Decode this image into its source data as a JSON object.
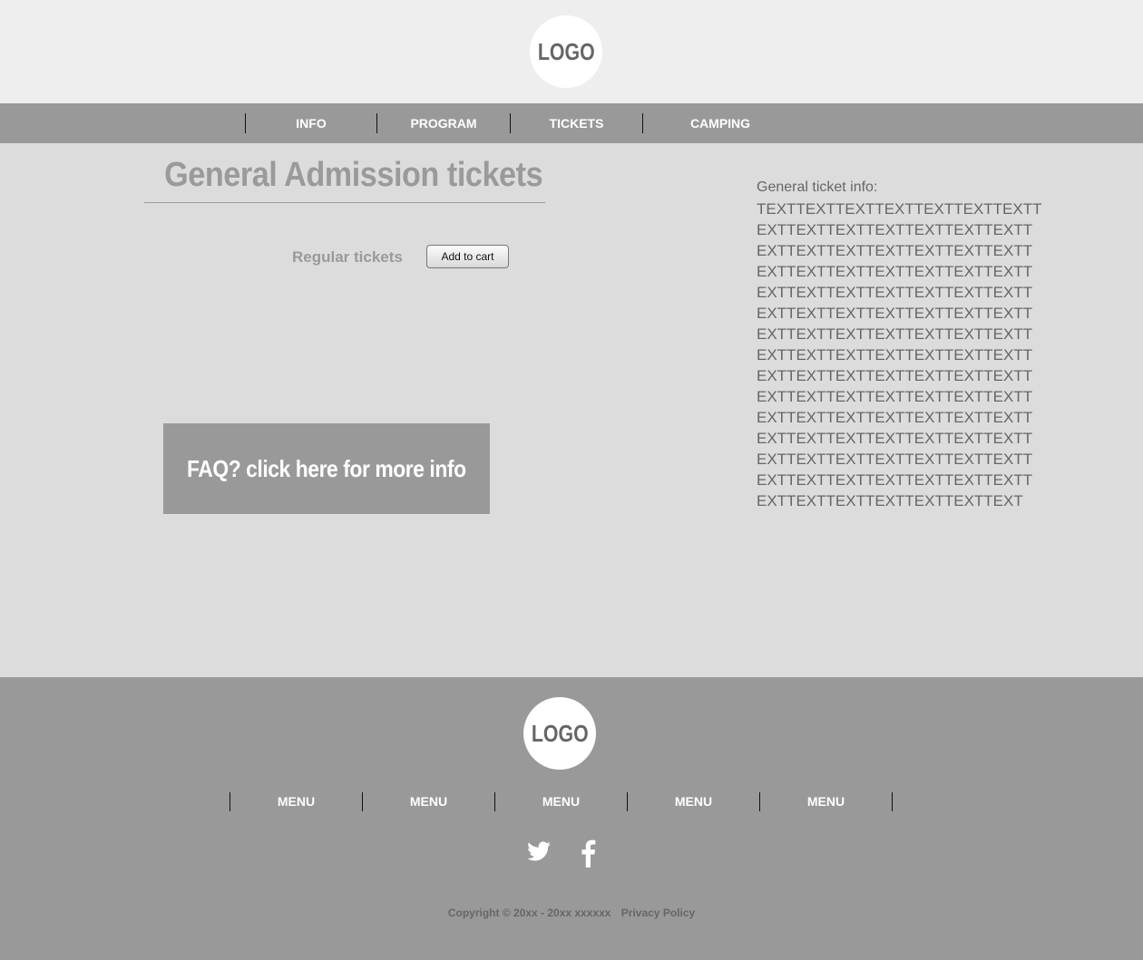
{
  "header": {
    "logo_text": "LOGO"
  },
  "nav": {
    "items": [
      {
        "label": "INFO"
      },
      {
        "label": "PROGRAM"
      },
      {
        "label": "TICKETS"
      },
      {
        "label": "CAMPING"
      }
    ]
  },
  "main": {
    "title": "General Admission tickets",
    "ticket_label": "Regular tickets",
    "add_to_cart_label": "Add to cart",
    "faq_label": "FAQ? click here for more info",
    "info_heading": "General ticket info:",
    "info_body": "TEXTTEXTTEXTTEXTTEXTTEXTTEXTTEXTTEXTTEXTTEXTTEXTTEXTTEXTTEXTTEXTTEXTTEXTTEXTTEXTTEXTTEXTTEXTTEXTTEXTTEXTTEXTTEXTTEXTTEXTTEXTTEXTTEXTTEXTTEXTTEXTTEXTTEXTTEXTTEXTTEXTTEXTTEXTTEXTTEXTTEXTTEXTTEXTTEXTTEXTTEXTTEXTTEXTTEXTTEXTTEXTTEXTTEXTTEXTTEXTTEXTTEXTTEXTTEXTTEXTTEXTTEXTTEXTTEXTTEXTTEXTTEXTTEXTTEXTTEXTTEXTTEXTTEXTTEXTTEXTTEXTTEXTTEXTTEXTTEXTTEXTTEXTTEXTTEXTTEXTTEXTTEXTTEXTTEXTTEXTTEXTTEXTTEXTTEXTTEXTTEXTTEXTTEXTTEXTTEXT"
  },
  "footer": {
    "logo_text": "LOGO",
    "menu": [
      {
        "label": "MENU"
      },
      {
        "label": "MENU"
      },
      {
        "label": "MENU"
      },
      {
        "label": "MENU"
      },
      {
        "label": "MENU"
      }
    ],
    "social_icons": [
      "twitter-icon",
      "facebook-icon"
    ],
    "copyright": "Copyright © 20xx - 20xx xxxxxx",
    "privacy_label": "Privacy Policy"
  },
  "colors": {
    "header_bg": "#eeeeee",
    "nav_bg": "#999999",
    "main_bg": "#dcdcdc",
    "footer_bg": "#999999",
    "heading_gray": "#9a9a9a",
    "text_gray": "#666666"
  }
}
